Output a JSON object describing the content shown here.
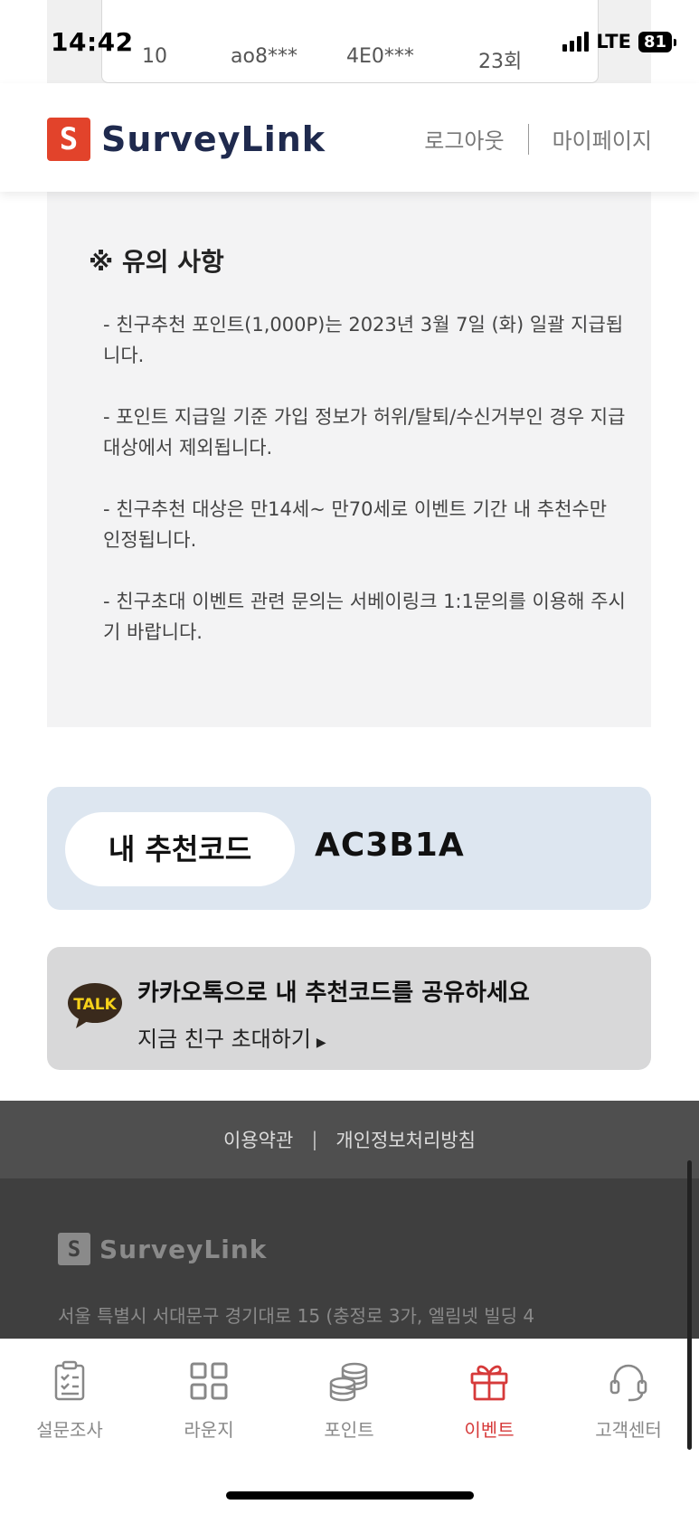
{
  "status_bar": {
    "time": "14:42",
    "network": "LTE",
    "battery": "81"
  },
  "peek_row": [
    "10",
    "ao8***",
    "4E0***",
    "23회"
  ],
  "header": {
    "brand": "SurveyLink",
    "logout": "로그아웃",
    "mypage": "마이페이지"
  },
  "notice": {
    "title": "※ 유의 사항",
    "items": [
      "- 친구추천 포인트(1,000P)는 2023년 3월 7일 (화) 일괄 지급됩니다.",
      "- 포인트 지급일 기준 가입 정보가 허위/탈퇴/수신거부인 경우 지급대상에서 제외됩니다.",
      "- 친구추천 대상은 만14세~ 만70세로 이벤트 기간 내 추천수만 인정됩니다.",
      "- 친구초대 이벤트 관련 문의는 서베이링크 1:1문의를 이용해 주시기 바랍니다."
    ]
  },
  "referral": {
    "label": "내 추천코드",
    "code": "AC3B1A"
  },
  "kakao": {
    "icon_text": "TALK",
    "title": "카카오톡으로 내 추천코드를 공유하세요",
    "subtitle": "지금 친구 초대하기"
  },
  "footer": {
    "terms": "이용약관",
    "privacy": "개인정보처리방침",
    "brand": "SurveyLink",
    "address": "서울 특별시 서대문구 경기대로 15 (충정로 3가, 엘림넷 빌딩 4"
  },
  "tabs": [
    {
      "label": "설문조사",
      "icon": "clipboard-icon"
    },
    {
      "label": "라운지",
      "icon": "grid-icon"
    },
    {
      "label": "포인트",
      "icon": "coins-icon"
    },
    {
      "label": "이벤트",
      "icon": "gift-icon",
      "active": true
    },
    {
      "label": "고객센터",
      "icon": "headset-icon"
    }
  ],
  "colors": {
    "brand_red": "#e2432b",
    "brand_navy": "#1f2a4e",
    "active_tab": "#d63a3a",
    "kakao_yellow": "#f7d21a"
  }
}
